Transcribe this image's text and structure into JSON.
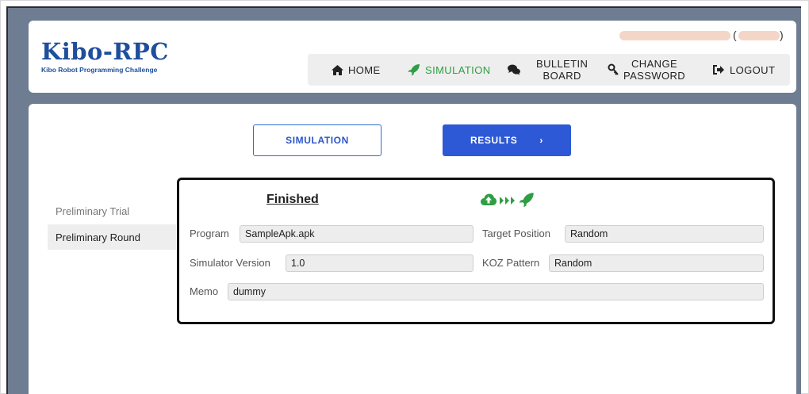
{
  "header": {
    "logo_title": "Kibo-RPC",
    "logo_subtitle": "Kibo Robot Programming Challenge",
    "user_paren_left": "(",
    "user_paren_right": ")"
  },
  "nav": {
    "items": [
      {
        "label": "HOME",
        "icon": "home-icon"
      },
      {
        "label": "SIMULATION",
        "icon": "rocket-icon",
        "active": true
      },
      {
        "label_line1": "BULLETIN",
        "label_line2": "BOARD",
        "icon": "chat-bubbles-icon"
      },
      {
        "label_line1": "CHANGE",
        "label_line2": "PASSWORD",
        "icon": "key-icon"
      },
      {
        "label": "LOGOUT",
        "icon": "sign-out-icon"
      }
    ]
  },
  "tabs": {
    "simulation": "SIMULATION",
    "results": "RESULTS",
    "results_chevron": "›"
  },
  "sidebar": {
    "items": [
      {
        "label": "Preliminary Trial",
        "selected": false
      },
      {
        "label": "Preliminary Round",
        "selected": true
      }
    ]
  },
  "result": {
    "status": "Finished",
    "status_icons": [
      "cloud-upload-icon",
      "triple-arrow-icon",
      "rocket-icon"
    ],
    "program_label": "Program",
    "program_value": "SampleApk.apk",
    "target_label": "Target Position",
    "target_value": "Random",
    "simver_label": "Simulator Version",
    "simver_value": "1.0",
    "koz_label": "KOZ Pattern",
    "koz_value": "Random",
    "memo_label": "Memo",
    "memo_value": "dummy"
  },
  "colors": {
    "background": "#6f7d92",
    "brand_blue": "#1e4f9c",
    "active_green": "#2f9e44",
    "primary_button": "#2d59d6"
  }
}
